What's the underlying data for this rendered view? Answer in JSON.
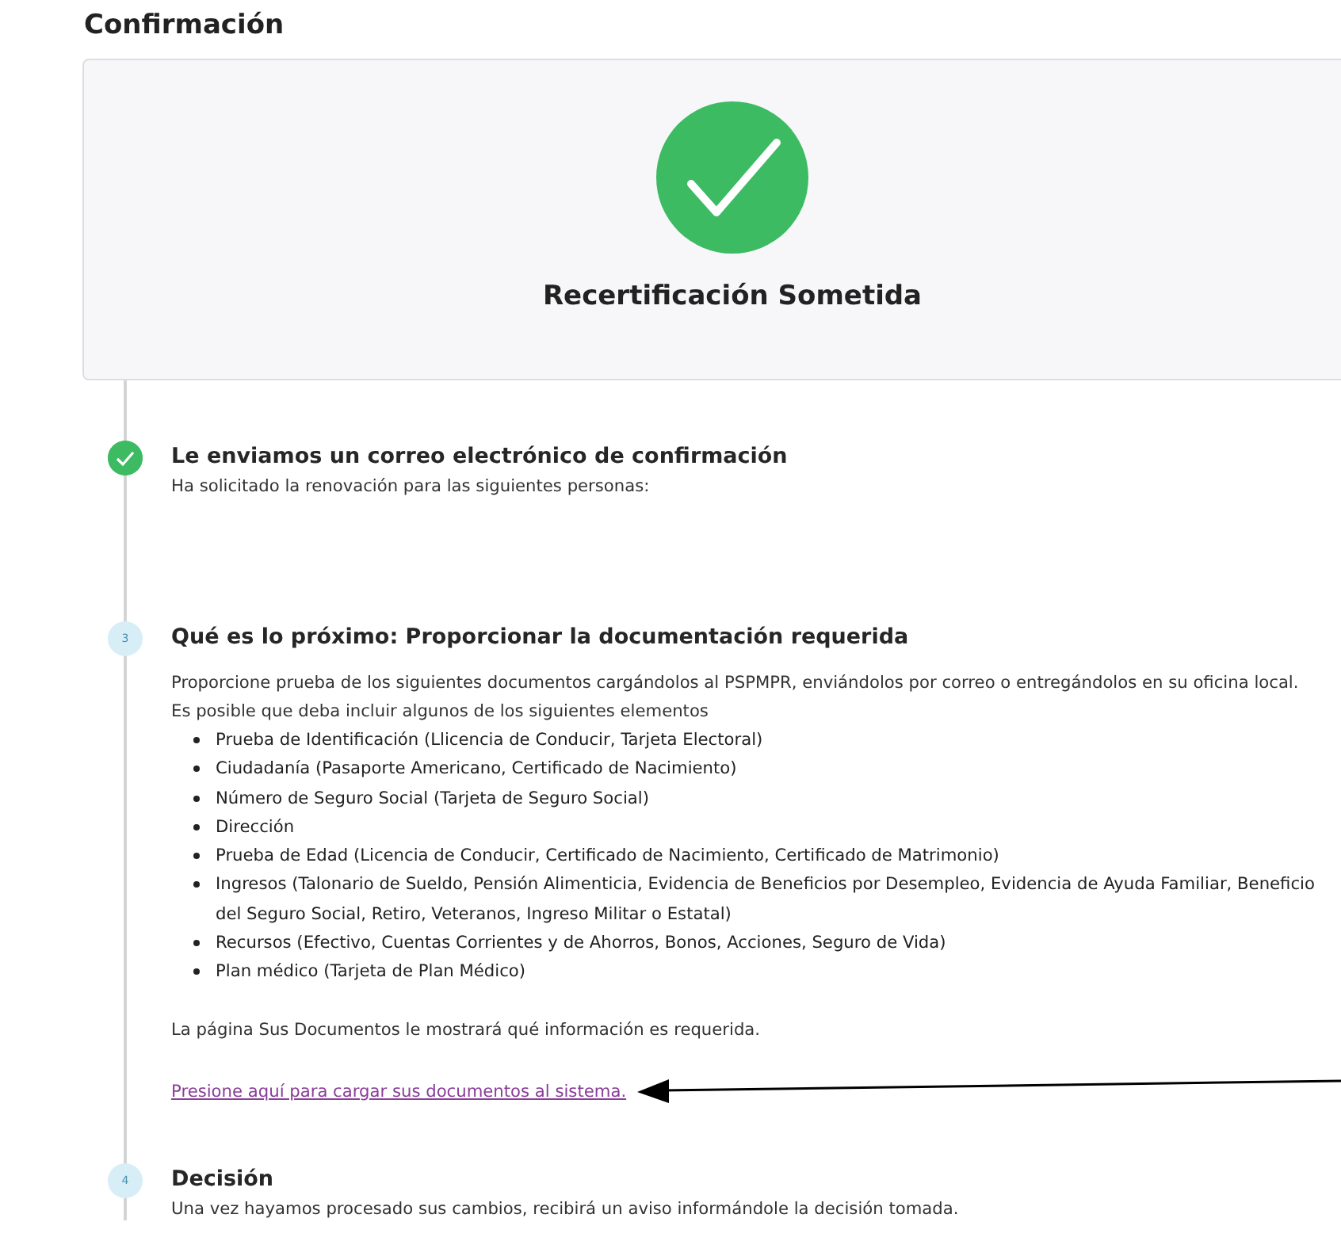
{
  "page_title": "Confirmación",
  "banner": {
    "title": "Recertificación Sometida"
  },
  "steps": [
    {
      "kind": "done",
      "title": "Le enviamos un correo electrónico de confirmación",
      "paragraphs": [
        "Ha solicitado la renovación para las siguientes personas:"
      ]
    },
    {
      "kind": "number",
      "number": "3",
      "title": "Qué es lo próximo: Proporcionar la documentación requerida",
      "paragraphs": [
        "Proporcione prueba de los siguientes documentos cargándolos al PSPMPR, enviándolos por correo o entregándolos en su oficina local.",
        "Es posible que deba incluir algunos de los siguientes elementos"
      ],
      "items": [
        "Prueba de Identificación (Llicencia de Conducir, Tarjeta Electoral)",
        "Ciudadanía (Pasaporte Americano, Certificado de Nacimiento)",
        "Número de Seguro Social (Tarjeta de Seguro Social)",
        "Dirección",
        "Prueba de Edad (Licencia de Conducir, Certificado de Nacimiento, Certificado de Matrimonio)",
        "Ingresos (Talonario de Sueldo, Pensión Alimenticia, Evidencia de Beneficios por Desempleo, Evidencia de Ayuda Familiar, Beneficio del Seguro Social, Retiro, Veteranos, Ingreso Militar o Estatal)",
        "Recursos (Efectivo, Cuentas Corrientes y de Ahorros, Bonos, Acciones, Seguro de Vida)",
        "Plan médico (Tarjeta de Plan Médico)"
      ],
      "note": "La página Sus Documentos le mostrará qué información es requerida.",
      "link": "Presione aquí para cargar sus documentos al sistema."
    },
    {
      "kind": "number",
      "number": "4",
      "title": "Decisión",
      "paragraphs": [
        "Una vez hayamos procesado sus cambios, recibirá un aviso informándole la decisión tomada."
      ]
    }
  ]
}
